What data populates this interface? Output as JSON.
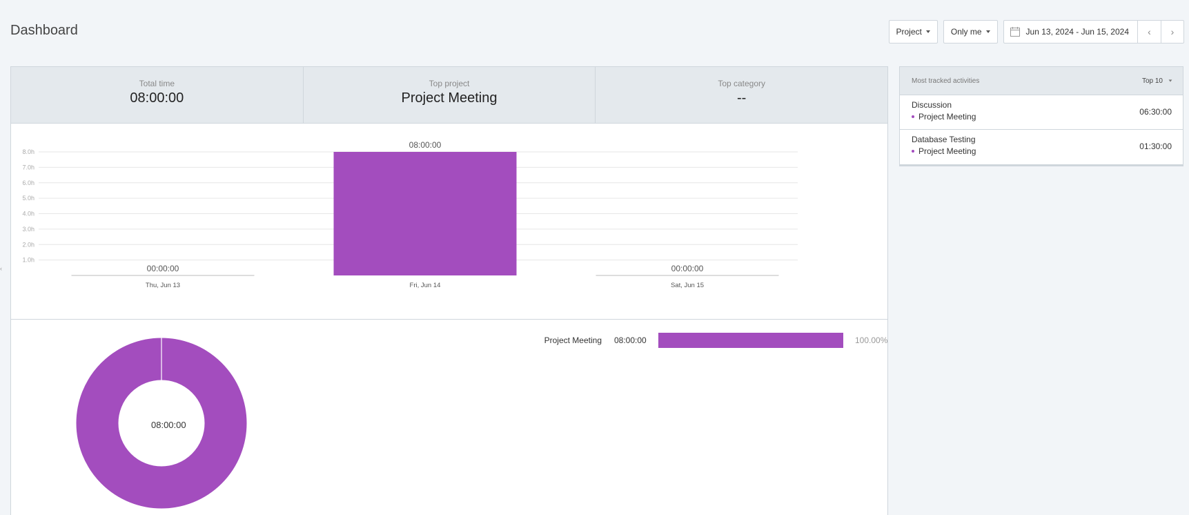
{
  "page": {
    "title": "Dashboard"
  },
  "toolbar": {
    "group_by_label": "Project",
    "filter_label": "Only me",
    "date_range": "Jun 13, 2024 - Jun 15, 2024",
    "prev_icon": "‹",
    "next_icon": "›"
  },
  "stats": [
    {
      "label": "Total time",
      "value": "08:00:00"
    },
    {
      "label": "Top project",
      "value": "Project Meeting"
    },
    {
      "label": "Top category",
      "value": "--"
    }
  ],
  "chart_data": [
    {
      "type": "bar",
      "categories": [
        "Thu, Jun 13",
        "Fri, Jun 14",
        "Sat, Jun 15"
      ],
      "values": [
        0,
        8,
        0
      ],
      "data_labels": [
        "00:00:00",
        "08:00:00",
        "00:00:00"
      ],
      "y_ticks": [
        "1.0h",
        "2.0h",
        "3.0h",
        "4.0h",
        "5.0h",
        "6.0h",
        "7.0h",
        "8.0h"
      ],
      "ylim": [
        0,
        8
      ],
      "grid": true,
      "color": "#a34dbe"
    },
    {
      "type": "pie",
      "style": "donut",
      "categories": [
        "Project Meeting"
      ],
      "values": [
        100
      ],
      "center_label": "08:00:00",
      "color": "#a34dbe"
    }
  ],
  "legend": [
    {
      "name": "Project Meeting",
      "time": "08:00:00",
      "percent_value": 100,
      "percent_label": "100.00%"
    }
  ],
  "side_panel": {
    "title": "Most tracked activities",
    "top_select": "Top 10",
    "activities": [
      {
        "name": "Discussion",
        "project": "Project Meeting",
        "time": "06:30:00"
      },
      {
        "name": "Database Testing",
        "project": "Project Meeting",
        "time": "01:30:00"
      }
    ]
  },
  "colors": {
    "accent": "#a34dbe",
    "background": "#f2f5f8",
    "header_bg": "#e4e9ed",
    "border": "#cfd6dc"
  }
}
